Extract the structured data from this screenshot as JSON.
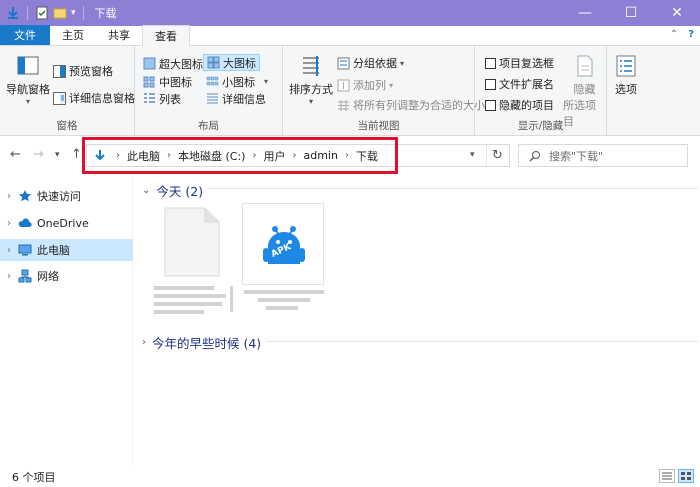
{
  "window": {
    "title": "下载"
  },
  "tabs": {
    "file": "文件",
    "home": "主页",
    "share": "共享",
    "view": "查看"
  },
  "ribbon": {
    "panes": {
      "nav_pane": "导航窗格",
      "preview_pane": "预览窗格",
      "details_pane": "详细信息窗格",
      "label": "窗格"
    },
    "layout": {
      "extra_large": "超大图标",
      "large": "大图标",
      "medium": "中图标",
      "small": "小图标",
      "list": "列表",
      "details": "详细信息",
      "label": "布局"
    },
    "current_view": {
      "sort_by": "排序方式",
      "group_by": "分组依据",
      "add_column": "添加列",
      "fit_columns": "将所有列调整为合适的大小",
      "label": "当前视图"
    },
    "show_hide": {
      "item_checkboxes": "项目复选框",
      "file_extensions": "文件扩展名",
      "hidden_items": "隐藏的项目",
      "hide": "隐藏",
      "hide_selected": "所选项目",
      "label": "显示/隐藏"
    },
    "options": "选项"
  },
  "address": {
    "crumbs": [
      "此电脑",
      "本地磁盘 (C:)",
      "用户",
      "admin",
      "下载"
    ]
  },
  "search": {
    "placeholder": "搜索\"下载\""
  },
  "nav": {
    "quick_access": "快速访问",
    "onedrive": "OneDrive",
    "this_pc": "此电脑",
    "network": "网络"
  },
  "content": {
    "group_today": "今天 (2)",
    "group_earlier": "今年的早些时候 (4)",
    "apk_label": "APK"
  },
  "status": {
    "count": "6 个项目"
  },
  "colors": {
    "titlebar": "#8e7fd6",
    "file_tab": "#1979ca",
    "selection": "#cce8ff",
    "highlight_box": "#e0102a",
    "apk_blue": "#1e88e5"
  }
}
